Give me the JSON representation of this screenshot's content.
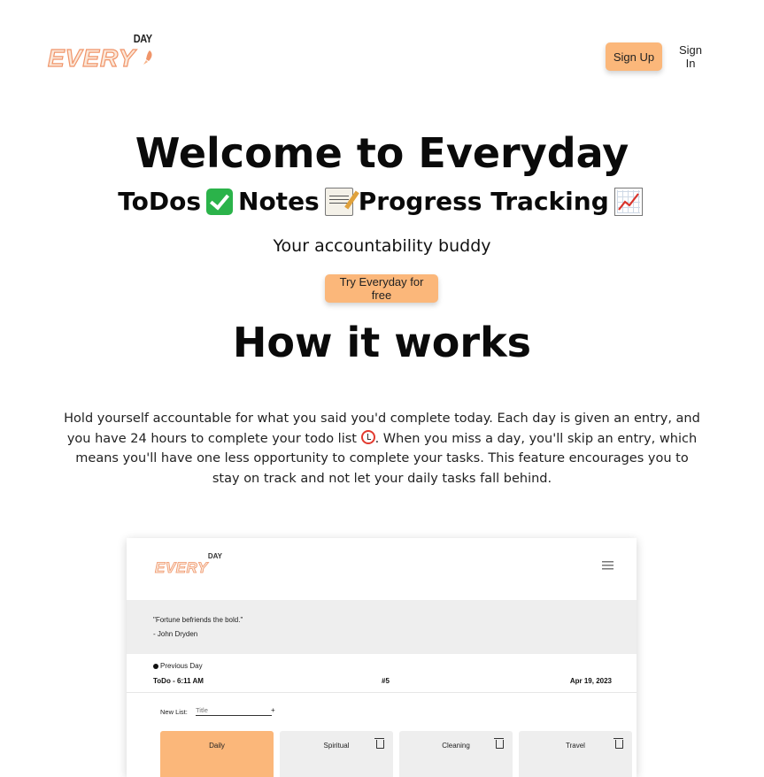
{
  "header": {
    "logo_day": "DAY",
    "logo_every": "EVERY",
    "signup_label": "Sign Up",
    "signin_label": "Sign In"
  },
  "hero": {
    "title": "Welcome to Everyday",
    "features": [
      "ToDos",
      "Notes",
      "Progress Tracking"
    ],
    "feature_icons": [
      "check-mark-icon",
      "memo-icon",
      "chart-increasing-icon"
    ],
    "tagline": "Your accountability buddy",
    "cta_label": "Try Everyday for free"
  },
  "how": {
    "title": "How it works",
    "text_before_icon": "Hold yourself accountable for what you said you'd complete today. Each day is given an entry, and you have 24 hours to complete your todo list ",
    "text_after_icon": ". When you miss a day, you'll skip an entry, which means you'll have one less opportunity to complete your tasks. This feature encourages you to stay on track and not let your daily tasks fall behind.",
    "icon": "alarm-clock-icon"
  },
  "preview": {
    "logo_day": "DAY",
    "logo_every": "EVERY",
    "quote": "\"Fortune befriends the bold.\"",
    "quote_author": "- John Dryden",
    "previous_day_label": "Previous Day",
    "todo_time": "ToDo - 6:11 AM",
    "entry_number": "#5",
    "date": "Apr 19, 2023",
    "new_list_label": "New List:",
    "title_placeholder": "Title",
    "add_symbol": "+",
    "lists": [
      "Daily",
      "Spiritual",
      "Cleaning",
      "Travel"
    ]
  },
  "colors": {
    "accent": "#fbb77a",
    "logo_stroke": "#f0956a",
    "panel_gray": "#eeeeee"
  }
}
